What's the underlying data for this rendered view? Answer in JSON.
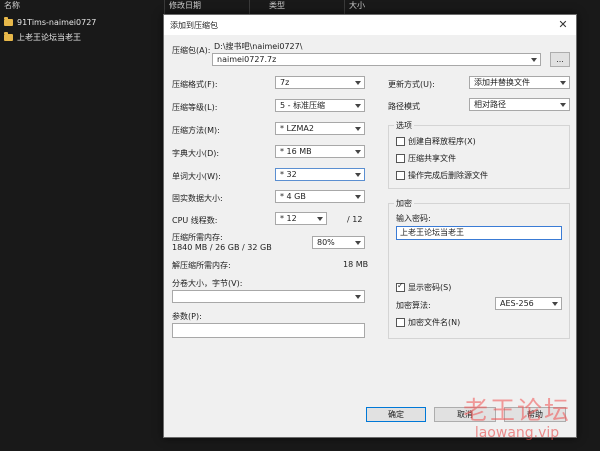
{
  "explorer": {
    "columns": [
      "名称",
      "修改日期",
      "类型",
      "大小"
    ],
    "files": [
      {
        "name": "91Tims-naimei0727"
      },
      {
        "name": "上老王论坛当老王"
      }
    ]
  },
  "dialog": {
    "title": "添加到压缩包",
    "close_glyph": "✕",
    "archive_label": "压缩包(A):",
    "archive_path": "D:\\搜书吧\\naimei0727\\",
    "archive_name": "naimei0727.7z",
    "browse_label": "...",
    "left": {
      "format_label": "压缩格式(F):",
      "format_value": "7z",
      "level_label": "压缩等级(L):",
      "level_value": "5 - 标准压缩",
      "method_label": "压缩方法(M):",
      "method_value": "* LZMA2",
      "dict_label": "字典大小(D):",
      "dict_value": "* 16 MB",
      "word_label": "单词大小(W):",
      "word_value": "* 32",
      "solid_label": "固实数据大小:",
      "solid_value": "* 4 GB",
      "threads_label": "CPU 线程数:",
      "threads_value": "* 12",
      "threads_total": "/ 12",
      "mem_label": "压缩所需内存:",
      "mem_detail": "1840 MB / 26 GB / 32 GB",
      "mem_percent": "80%",
      "decomp_label": "解压缩所需内存:",
      "decomp_value": "18 MB",
      "split_label": "分卷大小，字节(V):",
      "split_value": "",
      "params_label": "参数(P):",
      "params_value": ""
    },
    "right": {
      "update_label": "更新方式(U):",
      "update_value": "添加并替换文件",
      "path_label": "路径模式",
      "path_value": "相对路径",
      "options_title": "选项",
      "options": [
        {
          "label": "创建自释放程序(X)",
          "checked": false
        },
        {
          "label": "压缩共享文件",
          "checked": false
        },
        {
          "label": "操作完成后删除源文件",
          "checked": false
        }
      ],
      "encrypt_title": "加密",
      "password_label": "输入密码:",
      "password_value": "上老王论坛当老王",
      "show_password_label": "显示密码(S)",
      "show_password_checked": true,
      "enc_method_label": "加密算法:",
      "enc_method_value": "AES-256",
      "encrypt_names_label": "加密文件名(N)",
      "encrypt_names_checked": false
    },
    "buttons": {
      "ok": "确定",
      "cancel": "取消",
      "help": "帮助"
    }
  },
  "watermark": {
    "cn": "老王论坛",
    "en": "laowang.vip"
  }
}
